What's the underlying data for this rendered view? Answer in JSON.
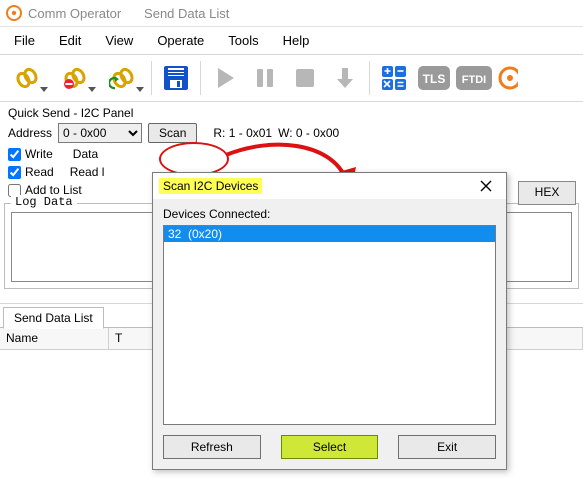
{
  "app": {
    "title": "Comm Operator",
    "subtitle": "Send Data List"
  },
  "menu": {
    "file": "File",
    "edit": "Edit",
    "view": "View",
    "operate": "Operate",
    "tools": "Tools",
    "help": "Help"
  },
  "toolbar_icons": {
    "link1": "link-icon",
    "link_remove": "link-remove-icon",
    "link_refresh": "link-refresh-icon",
    "save": "save-icon",
    "play": "play-icon",
    "pause": "pause-icon",
    "stop": "stop-icon",
    "download": "download-icon",
    "calc": "calculator-icon",
    "tls": "TLS",
    "ftdi": "FTDI",
    "target": "target-icon"
  },
  "i2c_panel": {
    "title": "Quick Send - I2C Panel",
    "address_label": "Address",
    "address_value": "0 - 0x00",
    "scan_label": "Scan",
    "r_label": "R: 1 - 0x01",
    "w_label": "W: 0 - 0x00",
    "write_label": "Write",
    "data_label": "Data",
    "read_label": "Read",
    "readlen_label": "Read l",
    "addlist_label": "Add to List",
    "hex_label": "HEX"
  },
  "log": {
    "title": "Log Data"
  },
  "tabs": {
    "senddatalist": "Send Data List"
  },
  "grid": {
    "col_name": "Name",
    "col_t": "T"
  },
  "scan_dialog": {
    "title": "Scan I2C Devices",
    "devices_label": "Devices Connected:",
    "items": [
      "32  (0x20)"
    ],
    "refresh": "Refresh",
    "select": "Select",
    "exit": "Exit"
  }
}
